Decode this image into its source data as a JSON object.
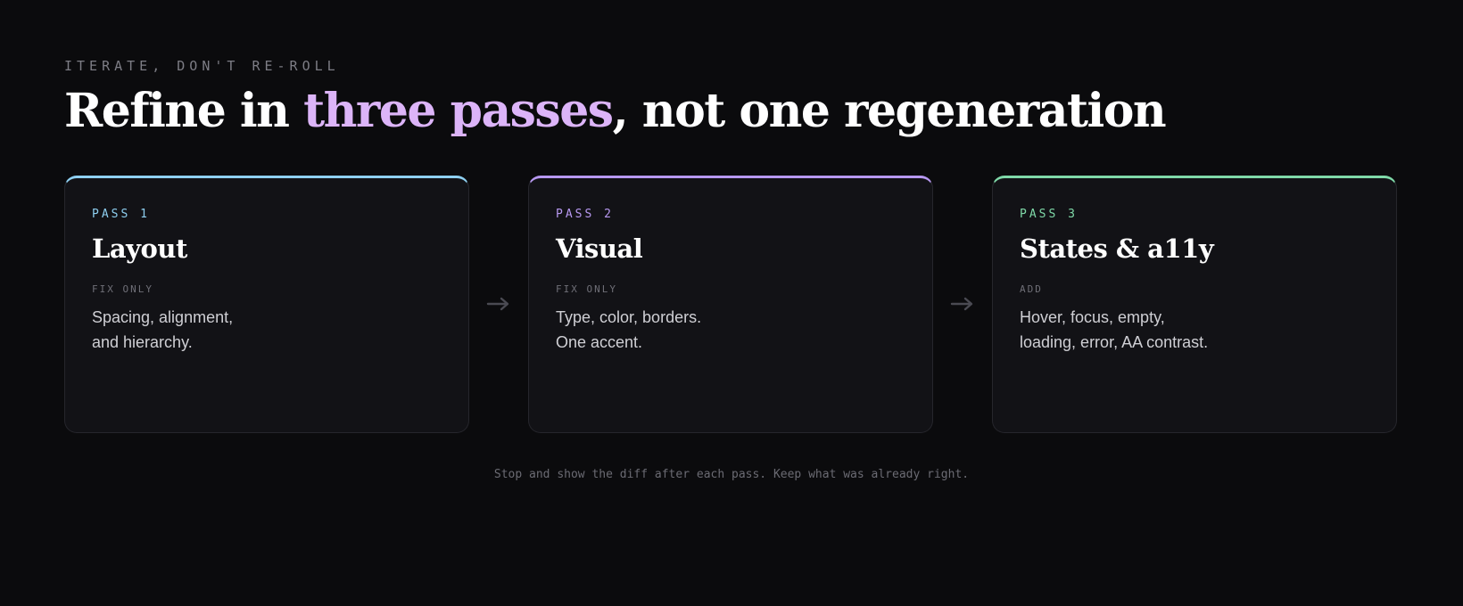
{
  "header": {
    "eyebrow": "ITERATE, DON'T RE-ROLL",
    "title_before": "Refine in ",
    "title_accent": "three passes",
    "title_after": ", not one regeneration"
  },
  "colors": {
    "background": "#0b0b0d",
    "headline_accent": "#dcb4f8",
    "pass1_accent": "#8ecff0",
    "pass2_accent": "#b798f0",
    "pass3_accent": "#7fd9a8"
  },
  "passes": [
    {
      "tag": "PASS 1",
      "title": "Layout",
      "kind": "FIX ONLY",
      "desc_lines": [
        "Spacing, alignment,",
        "and hierarchy."
      ]
    },
    {
      "tag": "PASS 2",
      "title": "Visual",
      "kind": "FIX ONLY",
      "desc_lines": [
        "Type, color, borders.",
        "One accent."
      ]
    },
    {
      "tag": "PASS 3",
      "title": "States & a11y",
      "kind": "ADD",
      "desc_lines": [
        "Hover, focus, empty,",
        "loading, error, AA contrast."
      ]
    }
  ],
  "connectors": [
    {
      "icon": "right-arrow-icon"
    },
    {
      "icon": "right-arrow-icon"
    }
  ],
  "footer": {
    "note": "Stop and show the diff after each pass. Keep what was already right."
  }
}
